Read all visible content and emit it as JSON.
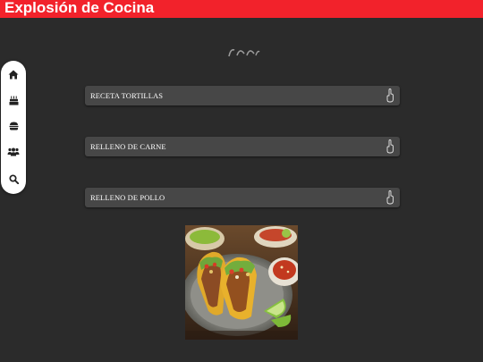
{
  "app": {
    "title": "Explosión de Cocina",
    "accent_color": "#f2222b",
    "background_color": "#2b2b2b"
  },
  "header": {
    "logo": "partial-logo-icon"
  },
  "sidebar": {
    "items": [
      {
        "icon": "home-icon"
      },
      {
        "icon": "birthday-cake-icon"
      },
      {
        "icon": "hamburger-icon"
      },
      {
        "icon": "users-icon"
      },
      {
        "icon": "search-icon"
      }
    ]
  },
  "recipes": [
    {
      "label": "RECETA TORTILLAS",
      "icon": "pointing-hand-icon"
    },
    {
      "label": "RELLENO DE CARNE",
      "icon": "pointing-hand-icon"
    },
    {
      "label": "RELLENO DE POLLO",
      "icon": "pointing-hand-icon"
    }
  ],
  "image": {
    "subject": "tacos-photo"
  }
}
